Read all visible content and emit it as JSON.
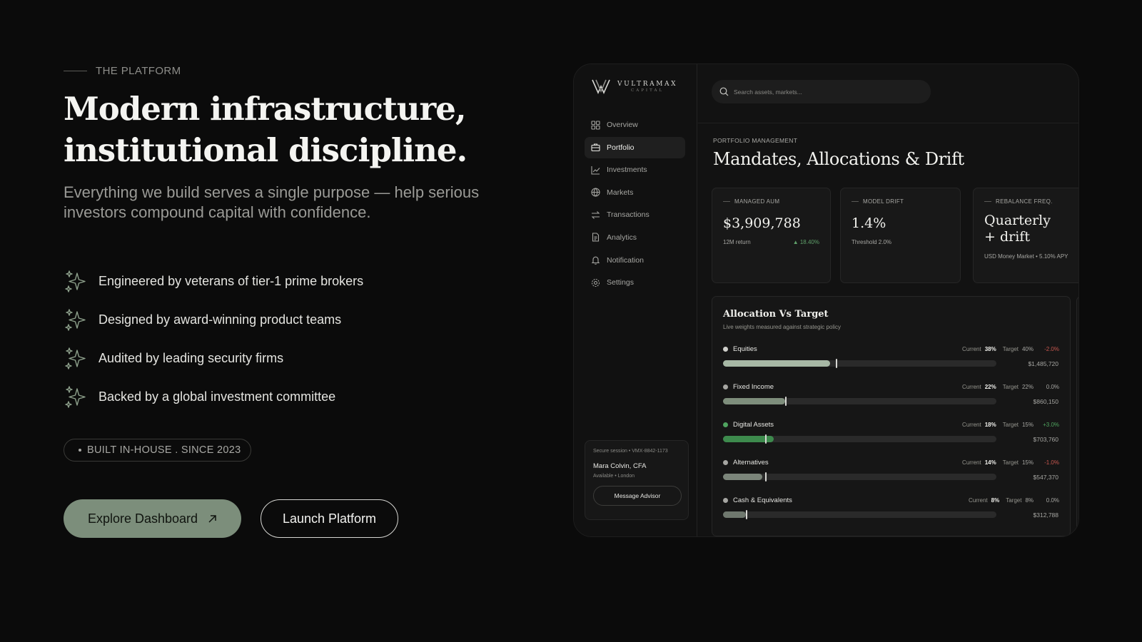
{
  "hero": {
    "eyebrow": "THE PLATFORM",
    "headline_line1": "Modern infrastructure,",
    "headline_line2": "institutional discipline.",
    "subhead": "Everything we build serves a single purpose — help serious investors compound capital with confidence.",
    "features": [
      {
        "icon": "sparkle-icon",
        "text": "Engineered by veterans of tier-1 prime brokers"
      },
      {
        "icon": "sparkle-icon",
        "text": "Designed by award-winning product teams"
      },
      {
        "icon": "sparkle-icon",
        "text": "Audited by leading security firms"
      },
      {
        "icon": "sparkle-icon",
        "text": "Backed by a global investment committee"
      }
    ],
    "badge": "BUILT IN-HOUSE . SINCE 2023",
    "primary_cta": "Explore Dashboard",
    "secondary_cta": "Launch Platform"
  },
  "dashboard": {
    "brand": {
      "name": "VULTRAMAX",
      "sub": "CAPITAL"
    },
    "nav": [
      {
        "label": "Overview",
        "icon": "grid-icon",
        "active": false
      },
      {
        "label": "Portfolio",
        "icon": "briefcase-icon",
        "active": true
      },
      {
        "label": "Investments",
        "icon": "chart-line-icon",
        "active": false
      },
      {
        "label": "Markets",
        "icon": "globe-icon",
        "active": false
      },
      {
        "label": "Transactions",
        "icon": "swap-icon",
        "active": false
      },
      {
        "label": "Analytics",
        "icon": "document-icon",
        "active": false
      },
      {
        "label": "Notification",
        "icon": "bell-icon",
        "active": false
      },
      {
        "label": "Settings",
        "icon": "gear-icon",
        "active": false
      }
    ],
    "session": {
      "top": "Secure session • VMX-8842-1173",
      "name": "Mara Colvin, CFA",
      "status": "Available • London",
      "button": "Message Advisor"
    },
    "search": {
      "placeholder": "Search assets, markets..."
    },
    "section_eyebrow": "PORTFOLIO MANAGEMENT",
    "section_title": "Mandates, Allocations & Drift",
    "kpis": {
      "aum": {
        "label": "MANAGED AUM",
        "value": "$3,909,788",
        "foot_left": "12M return",
        "foot_right": "▲ 18.40%"
      },
      "drift": {
        "label": "MODEL DRIFT",
        "value": "1.4%",
        "foot_left": "Threshold 2.0%"
      },
      "rebalance": {
        "label": "REBALANCE FREQ.",
        "value_line1": "Quarterly",
        "value_line2": "+ drift",
        "foot_left": "USD Money Market • 5.10% APY"
      }
    },
    "allocation": {
      "title": "Allocation Vs Target",
      "subtitle": "Live weights measured against strategic policy",
      "current_label": "Current",
      "target_label": "Target",
      "rows": [
        {
          "name": "Equities",
          "current": "38%",
          "target": "40%",
          "delta": "-2.0%",
          "delta_sign": "neg",
          "amount": "$1,485,720",
          "current_pct": 38,
          "target_pct": 40,
          "color": "#a7b8a5",
          "dot": "#cfcfcb"
        },
        {
          "name": "Fixed Income",
          "current": "22%",
          "target": "22%",
          "delta": "0.0%",
          "delta_sign": "zero",
          "amount": "$860,150",
          "current_pct": 22,
          "target_pct": 22,
          "color": "#7e8e7c",
          "dot": "#a6a6a2"
        },
        {
          "name": "Digital Assets",
          "current": "18%",
          "target": "15%",
          "delta": "+3.0%",
          "delta_sign": "pos",
          "amount": "$703,760",
          "current_pct": 18,
          "target_pct": 15,
          "color": "#3d8a4d",
          "dot": "#4fa45f"
        },
        {
          "name": "Alternatives",
          "current": "14%",
          "target": "15%",
          "delta": "-1.0%",
          "delta_sign": "neg",
          "amount": "$547,370",
          "current_pct": 14,
          "target_pct": 15,
          "color": "#7b857a",
          "dot": "#a6a6a2"
        },
        {
          "name": "Cash & Equivalents",
          "current": "8%",
          "target": "8%",
          "delta": "0.0%",
          "delta_sign": "zero",
          "amount": "$312,788",
          "current_pct": 8,
          "target_pct": 8,
          "color": "#6f786e",
          "dot": "#a6a6a2"
        }
      ]
    }
  }
}
